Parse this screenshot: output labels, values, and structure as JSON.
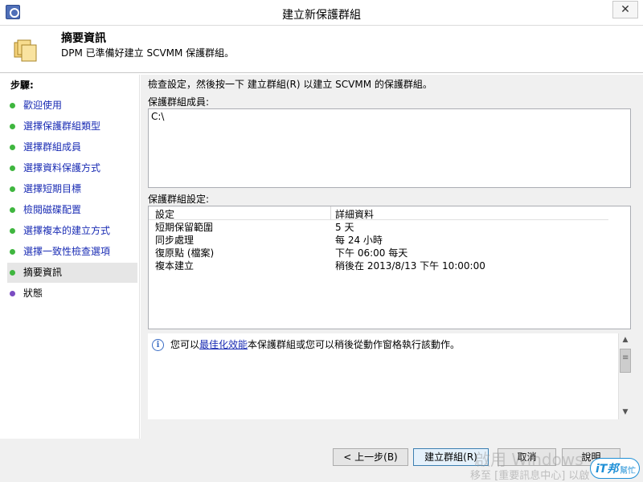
{
  "window": {
    "title": "建立新保護群組",
    "close_glyph": "✕"
  },
  "header": {
    "title": "摘要資訊",
    "subtitle": "DPM 已準備好建立 SCVMM 保護群組。"
  },
  "steps": {
    "heading": "步驟:",
    "items": [
      {
        "label": "歡迎使用",
        "state": "done"
      },
      {
        "label": "選擇保護群組類型",
        "state": "done"
      },
      {
        "label": "選擇群組成員",
        "state": "done"
      },
      {
        "label": "選擇資料保護方式",
        "state": "done"
      },
      {
        "label": "選擇短期目標",
        "state": "done"
      },
      {
        "label": "檢閱磁碟配置",
        "state": "done"
      },
      {
        "label": "選擇複本的建立方式",
        "state": "done"
      },
      {
        "label": "選擇一致性檢查選項",
        "state": "done"
      },
      {
        "label": "摘要資訊",
        "state": "current"
      },
      {
        "label": "狀態",
        "state": "pending"
      }
    ]
  },
  "main": {
    "instruction": "檢查設定，然後按一下 建立群組(R) 以建立 SCVMM 的保護群組。",
    "members_label": "保護群組成員:",
    "members": [
      "C:\\"
    ],
    "settings_label": "保護群組設定:",
    "settings_columns": [
      "設定",
      "詳細資料"
    ],
    "settings_rows": [
      [
        "短期保留範圍",
        "5 天"
      ],
      [
        "同步處理",
        "每 24 小時"
      ],
      [
        "復原點 (檔案)",
        "下午 06:00 每天"
      ],
      [
        "複本建立",
        "稍後在 2013/8/13 下午 10:00:00"
      ]
    ],
    "info": {
      "prefix": "您可以",
      "link": "最佳化效能",
      "suffix": "本保護群組或您可以稍後從動作窗格執行該動作。"
    }
  },
  "buttons": {
    "back": "< 上一步(B)",
    "create": "建立群組(R)",
    "cancel": "取消",
    "help": "說明"
  },
  "watermark": {
    "line1": "啟用 Windows",
    "line2": "移至 [重要訊息中心] 以啟",
    "logo_a": "iT邦",
    "logo_b": "幫忙"
  },
  "colors": {
    "link": "#1a2cb4",
    "done_dot": "#3fb63f",
    "pending_dot": "#7a4cc2"
  }
}
